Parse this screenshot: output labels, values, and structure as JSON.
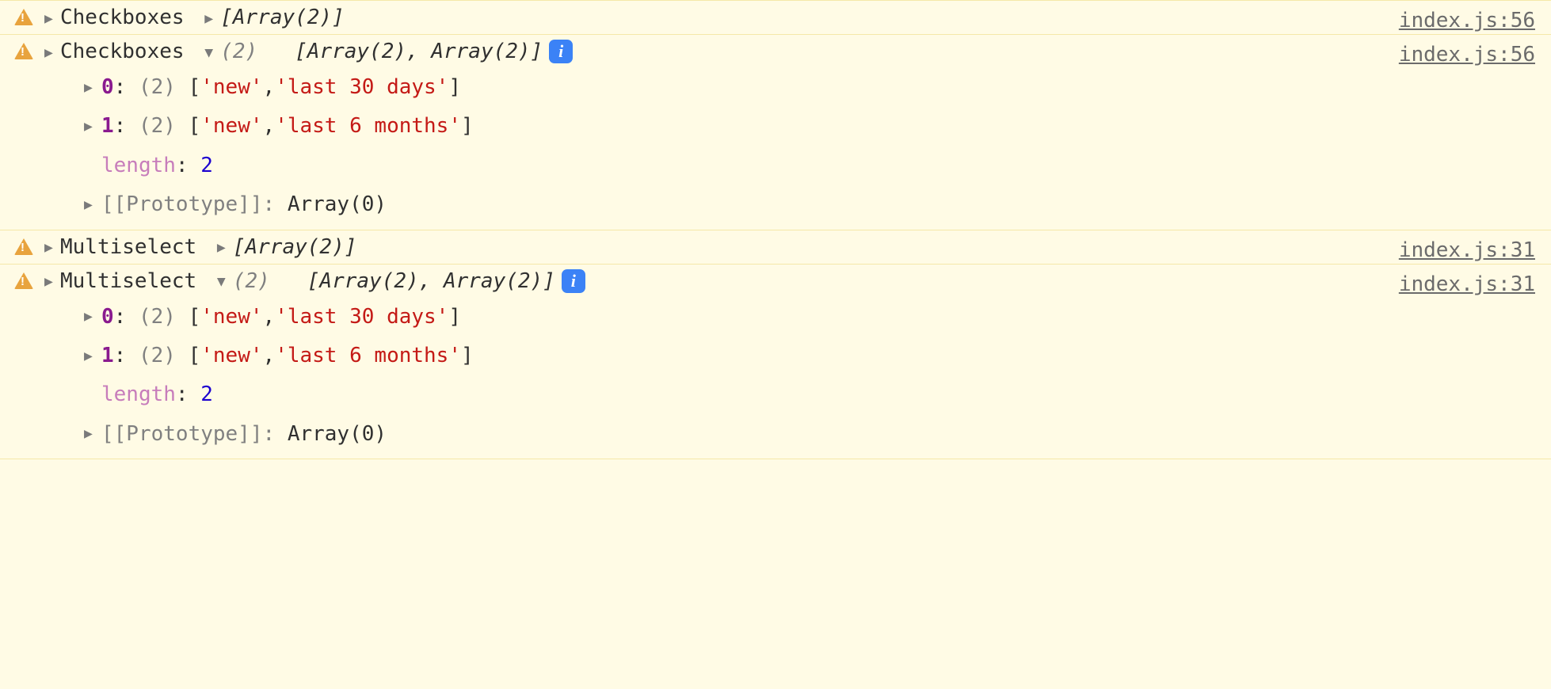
{
  "rows": [
    {
      "label": "Checkboxes",
      "source": "index.js:56",
      "expanded": false,
      "collapsedPreview": "[Array(2)]"
    },
    {
      "label": "Checkboxes",
      "source": "index.js:56",
      "expanded": true,
      "count": "(2)",
      "expandedPreview": "[Array(2), Array(2)]",
      "items": [
        {
          "index": "0",
          "count": "(2)",
          "vals": [
            "'new'",
            "'last 30 days'"
          ]
        },
        {
          "index": "1",
          "count": "(2)",
          "vals": [
            "'new'",
            "'last 6 months'"
          ]
        }
      ],
      "lengthLabel": "length",
      "lengthValue": "2",
      "protoLabel": "[[Prototype]]",
      "protoValue": "Array(0)"
    },
    {
      "label": "Multiselect",
      "source": "index.js:31",
      "expanded": false,
      "collapsedPreview": "[Array(2)]"
    },
    {
      "label": "Multiselect",
      "source": "index.js:31",
      "expanded": true,
      "count": "(2)",
      "expandedPreview": "[Array(2), Array(2)]",
      "items": [
        {
          "index": "0",
          "count": "(2)",
          "vals": [
            "'new'",
            "'last 30 days'"
          ]
        },
        {
          "index": "1",
          "count": "(2)",
          "vals": [
            "'new'",
            "'last 6 months'"
          ]
        }
      ],
      "lengthLabel": "length",
      "lengthValue": "2",
      "protoLabel": "[[Prototype]]",
      "protoValue": "Array(0)"
    }
  ]
}
